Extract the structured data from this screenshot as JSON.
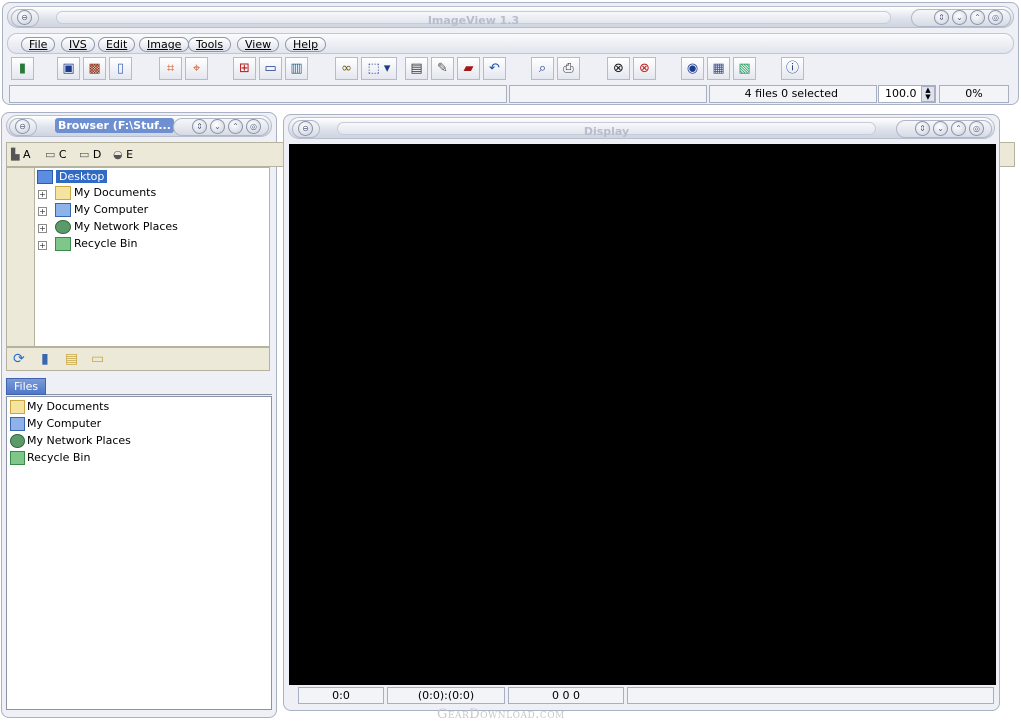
{
  "main_window": {
    "title": "ImageView 1.3",
    "menus": [
      "File",
      "IVS",
      "Edit",
      "Image",
      "Tools",
      "View",
      "Help"
    ],
    "status": {
      "files": "4 files  0 selected",
      "zoom": "100.0",
      "progress": "0%"
    }
  },
  "browser": {
    "title": "Browser (F:\\Stuf...",
    "drives": [
      "A",
      "C",
      "D",
      "E"
    ],
    "tree": {
      "root": "Desktop",
      "items": [
        "My Documents",
        "My Computer",
        "My Network Places",
        "Recycle Bin"
      ]
    },
    "files_tab": "Files",
    "files": [
      "My Documents",
      "My Computer",
      "My Network Places",
      "Recycle Bin"
    ]
  },
  "display": {
    "title": "Display",
    "status": [
      "0:0",
      "(0:0):(0:0)",
      "0 0 0"
    ]
  },
  "watermark": "GearDownload.com",
  "colors": {
    "selection": "#316ac5",
    "display_bg": "#000000",
    "chrome": "#eef0f6"
  }
}
